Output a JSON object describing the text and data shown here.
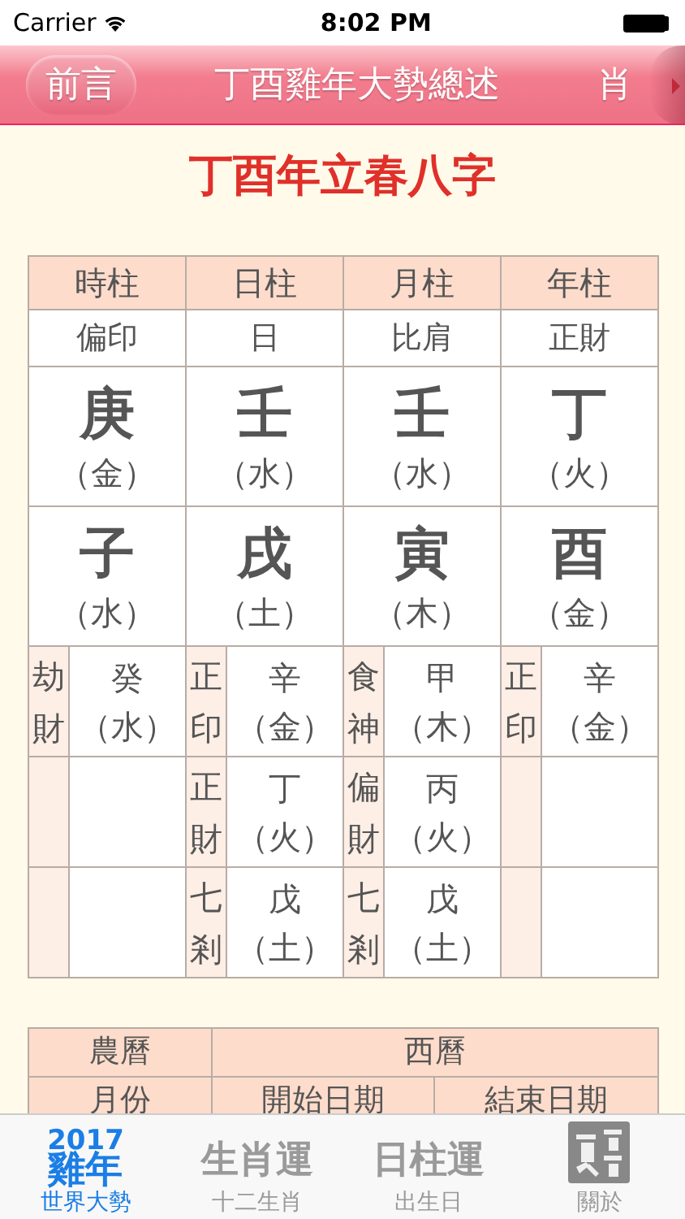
{
  "status_bar": {
    "carrier": "Carrier",
    "time": "8:02 PM"
  },
  "nav_tabs": [
    {
      "label": "前言",
      "selected": true
    },
    {
      "label": "丁酉雞年大勢總述",
      "selected": false
    },
    {
      "label": "肖",
      "selected": false
    }
  ],
  "title": "丁酉年立春八字",
  "pillars": {
    "headers": [
      "時柱",
      "日柱",
      "月柱",
      "年柱"
    ],
    "ten_gods": [
      "偏印",
      "日",
      "比肩",
      "正財"
    ],
    "stems": [
      {
        "char": "庚",
        "element": "（金）"
      },
      {
        "char": "壬",
        "element": "（水）"
      },
      {
        "char": "壬",
        "element": "（水）"
      },
      {
        "char": "丁",
        "element": "（火）"
      }
    ],
    "branches": [
      {
        "char": "子",
        "element": "（水）"
      },
      {
        "char": "戌",
        "element": "（土）"
      },
      {
        "char": "寅",
        "element": "（木）"
      },
      {
        "char": "酉",
        "element": "（金）"
      }
    ],
    "hidden_stems": [
      [
        {
          "god": "劫財",
          "char": "癸",
          "element": "（水）"
        }
      ],
      [
        {
          "god": "正印",
          "char": "辛",
          "element": "（金）"
        },
        {
          "god": "正財",
          "char": "丁",
          "element": "（火）"
        },
        {
          "god": "七剎",
          "char": "戊",
          "element": "（土）"
        }
      ],
      [
        {
          "god": "食神",
          "char": "甲",
          "element": "（木）"
        },
        {
          "god": "偏財",
          "char": "丙",
          "element": "（火）"
        },
        {
          "god": "七剎",
          "char": "戊",
          "element": "（土）"
        }
      ],
      [
        {
          "god": "正印",
          "char": "辛",
          "element": "（金）"
        }
      ]
    ]
  },
  "calendar_table": {
    "header_row": [
      "農曆",
      "西曆"
    ],
    "sub_row": [
      "月份",
      "開始日期",
      "結束日期"
    ]
  },
  "tab_bar": [
    {
      "kind": "text",
      "icon_lines": [
        "2017",
        "雞年"
      ],
      "label": "世界大勢",
      "selected": true
    },
    {
      "kind": "text",
      "icon_lines": [
        "生肖運"
      ],
      "label": "十二生肖",
      "selected": false
    },
    {
      "kind": "text",
      "icon_lines": [
        "日柱運"
      ],
      "label": "出生日",
      "selected": false
    },
    {
      "kind": "seal",
      "label": "關於",
      "selected": false
    }
  ]
}
